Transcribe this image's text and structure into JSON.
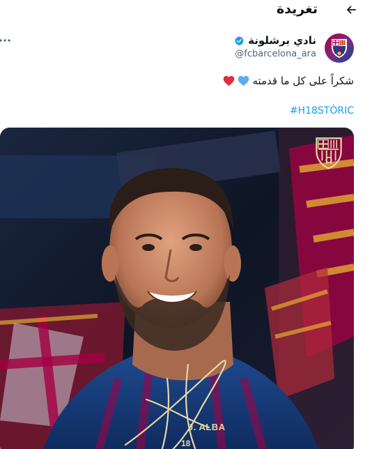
{
  "header": {
    "title": "تغريدة",
    "back_icon": "arrow-left-icon"
  },
  "tweet": {
    "author": {
      "display_name": "نادي برشلونة",
      "handle": "@fcbarcelona_ara",
      "verified": true,
      "avatar_icon": "fc-barcelona-crest-icon"
    },
    "more_icon": "more-horizontal-icon",
    "text": "شكراً على كل ما قدمته",
    "emojis": [
      "blue-heart-icon",
      "red-heart-icon"
    ],
    "hashtag": "#H18STÒRIC",
    "media": {
      "description_icon": "player-photo",
      "overlay_text": "J. ALBA",
      "overlay_number": "18"
    }
  },
  "colors": {
    "link": "#1d9bf0",
    "secondary_text": "#536471",
    "blaugrana_blue": "#004d98",
    "blaugrana_red": "#a50044",
    "gold": "#e7d6a4"
  }
}
